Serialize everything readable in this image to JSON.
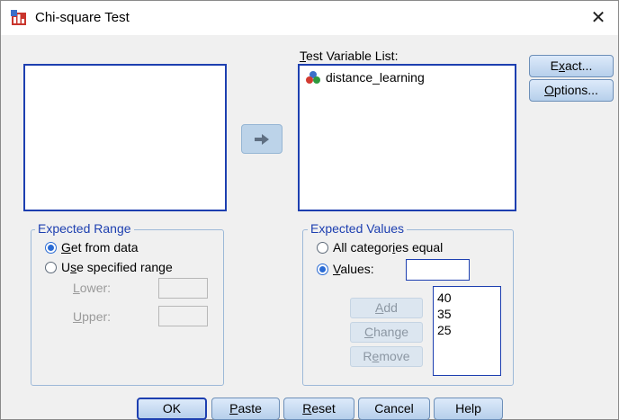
{
  "window": {
    "title": "Chi-square Test",
    "close_glyph": "✕"
  },
  "variables": {
    "source_items": [],
    "test_list_label_underlined": "T",
    "test_list_label_rest": "est Variable List:",
    "test_items": [
      {
        "name": "distance_learning",
        "icon": "nominal-variable-icon"
      }
    ]
  },
  "side_buttons": {
    "exact": {
      "pre": "E",
      "ul": "x",
      "post": "act..."
    },
    "options": {
      "pre": "",
      "ul": "O",
      "post": "ptions..."
    }
  },
  "expected_range": {
    "legend": "Expected Range",
    "get_from_data": {
      "pre": "",
      "ul": "G",
      "post": "et from data",
      "selected": true
    },
    "use_specified": {
      "pre": "U",
      "ul": "s",
      "post": "e specified range",
      "selected": false
    },
    "lower": {
      "pre": "",
      "ul": "L",
      "post": "ower:",
      "value": ""
    },
    "upper": {
      "pre": "",
      "ul": "U",
      "post": "pper:",
      "value": ""
    }
  },
  "expected_values": {
    "legend": "Expected Values",
    "all_equal": {
      "pre": "All categor",
      "ul": "i",
      "post": "es equal",
      "selected": false
    },
    "values": {
      "pre": "",
      "ul": "V",
      "post": "alues:",
      "selected": true,
      "input_value": ""
    },
    "add": {
      "pre": "",
      "ul": "A",
      "post": "dd"
    },
    "change": {
      "pre": "",
      "ul": "C",
      "post": "hange"
    },
    "remove": {
      "pre": "R",
      "ul": "e",
      "post": "move"
    },
    "list": [
      "40",
      "35",
      "25"
    ]
  },
  "bottom_buttons": {
    "ok": {
      "pre": "OK",
      "ul": "",
      "post": ""
    },
    "paste": {
      "pre": "",
      "ul": "P",
      "post": "aste"
    },
    "reset": {
      "pre": "",
      "ul": "R",
      "post": "eset"
    },
    "cancel": {
      "pre": "Cancel",
      "ul": "",
      "post": ""
    },
    "help": {
      "pre": "Help",
      "ul": "",
      "post": ""
    }
  },
  "colors": {
    "accent": "#1d3fb0",
    "button_top": "#ddeafa",
    "button_bottom": "#b6cfeb",
    "dialog_bg": "#f0f0f0"
  }
}
